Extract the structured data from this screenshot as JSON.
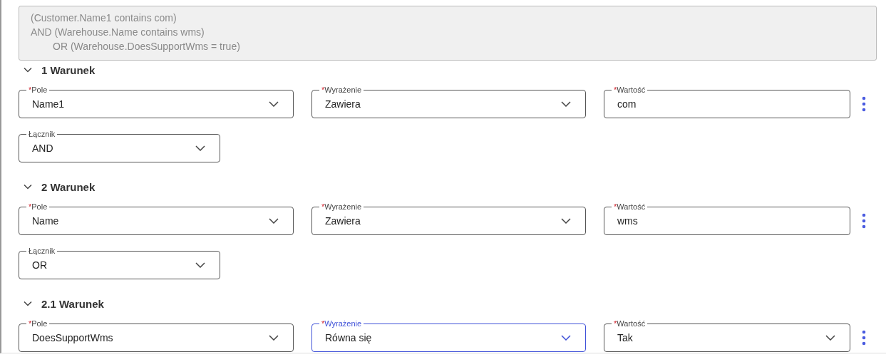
{
  "query": {
    "lines": [
      {
        "text": "(Customer.Name1 contains com)",
        "indented": false
      },
      {
        "text": "AND (Warehouse.Name contains wms)",
        "indented": false
      },
      {
        "text": "OR (Warehouse.DoesSupportWms = true)",
        "indented": true
      }
    ]
  },
  "conditions": [
    {
      "title": "1 Warunek",
      "expanded": true,
      "fields": [
        {
          "kind": "select",
          "required_mark": "*",
          "label": "Pole",
          "value": "Name1",
          "focused": false
        },
        {
          "kind": "select",
          "required_mark": "*",
          "label": "Wyrażenie",
          "value": "Zawiera",
          "focused": false
        },
        {
          "kind": "text",
          "required_mark": "*",
          "label": "Wartość",
          "value": "com",
          "focused": false
        }
      ],
      "connector": {
        "label": "Łącznik",
        "value": "AND"
      }
    },
    {
      "title": "2 Warunek",
      "expanded": true,
      "fields": [
        {
          "kind": "select",
          "required_mark": "*",
          "label": "Pole",
          "value": "Name",
          "focused": false
        },
        {
          "kind": "select",
          "required_mark": "*",
          "label": "Wyrażenie",
          "value": "Zawiera",
          "focused": false
        },
        {
          "kind": "text",
          "required_mark": "*",
          "label": "Wartość",
          "value": "wms",
          "focused": false
        }
      ],
      "connector": {
        "label": "Łącznik",
        "value": "OR"
      }
    },
    {
      "title": "2.1 Warunek",
      "expanded": true,
      "fields": [
        {
          "kind": "select",
          "required_mark": "*",
          "label": "Pole",
          "value": "DoesSupportWms",
          "focused": false
        },
        {
          "kind": "select",
          "required_mark": "*",
          "label": "Wyrażenie",
          "value": "Równa się",
          "focused": true
        },
        {
          "kind": "select",
          "required_mark": "*",
          "label": "Wartość",
          "value": "Tak",
          "focused": false
        }
      ]
    }
  ]
}
